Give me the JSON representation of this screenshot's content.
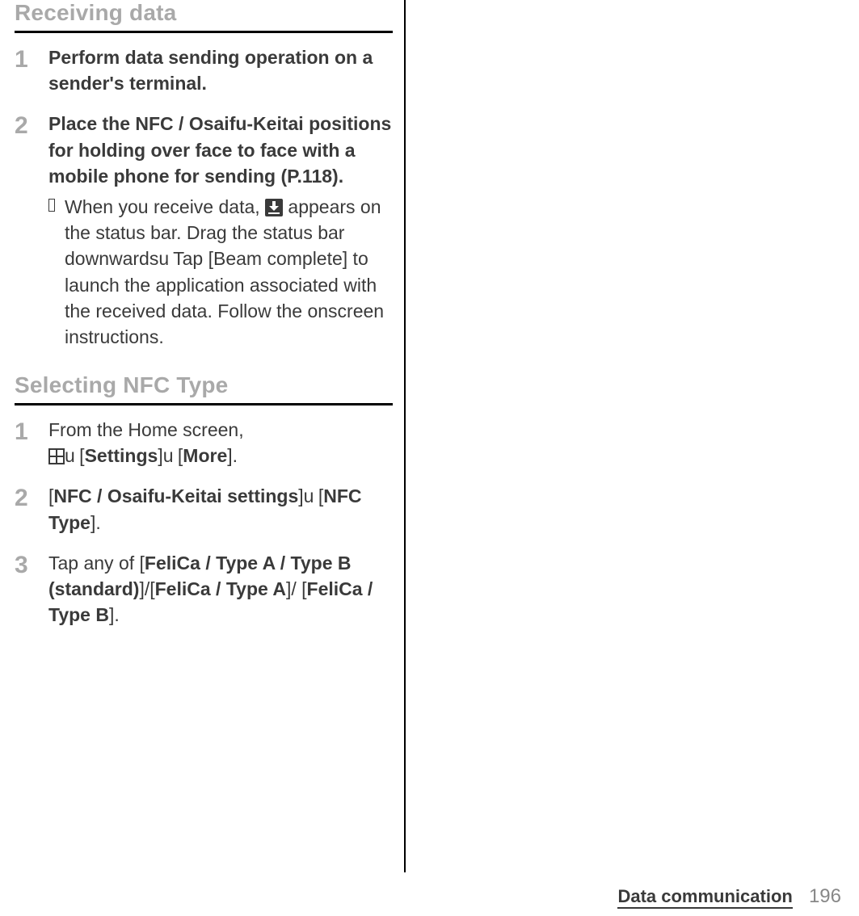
{
  "section1": {
    "heading": "Receiving data",
    "steps": [
      {
        "num": "1",
        "bold": "Perform data sending operation on a sender's terminal."
      },
      {
        "num": "2",
        "bold": "Place the NFC / Osaifu-Keitai positions for holding over face to face with a mobile phone for sending (P.118).",
        "note_before_icon": "When you receive data, ",
        "note_after_icon": " appears on the status bar. Drag the status bar downwards",
        "note_sep": "u",
        "note_tail": " Tap [Beam complete] to launch the application associated with the received data. Follow the onscreen instructions."
      }
    ]
  },
  "section2": {
    "heading": "Selecting NFC Type",
    "steps": [
      {
        "num": "1",
        "pre": "From the Home screen, ",
        "sep1": "u",
        "bracket_open1": " [",
        "settings": "Settings",
        "bracket_close1": "]",
        "sep2": "u",
        "bracket_open2": " [",
        "more": "More",
        "bracket_close2": "]."
      },
      {
        "num": "2",
        "open1": "[",
        "nfc_settings": "NFC / Osaifu-Keitai settings",
        "close1": "]",
        "sep": "u",
        "open2": " [",
        "nfc_type": "NFC Type",
        "close2": "]."
      },
      {
        "num": "3",
        "pre": "Tap any of [",
        "opt1": "FeliCa / Type A / Type B (standard)",
        "mid1": "]/[",
        "opt2": "FeliCa / Type A",
        "mid2": "]/ [",
        "opt3": "FeliCa / Type B",
        "end": "]."
      }
    ]
  },
  "footer": {
    "label": "Data communication",
    "page": "196"
  }
}
